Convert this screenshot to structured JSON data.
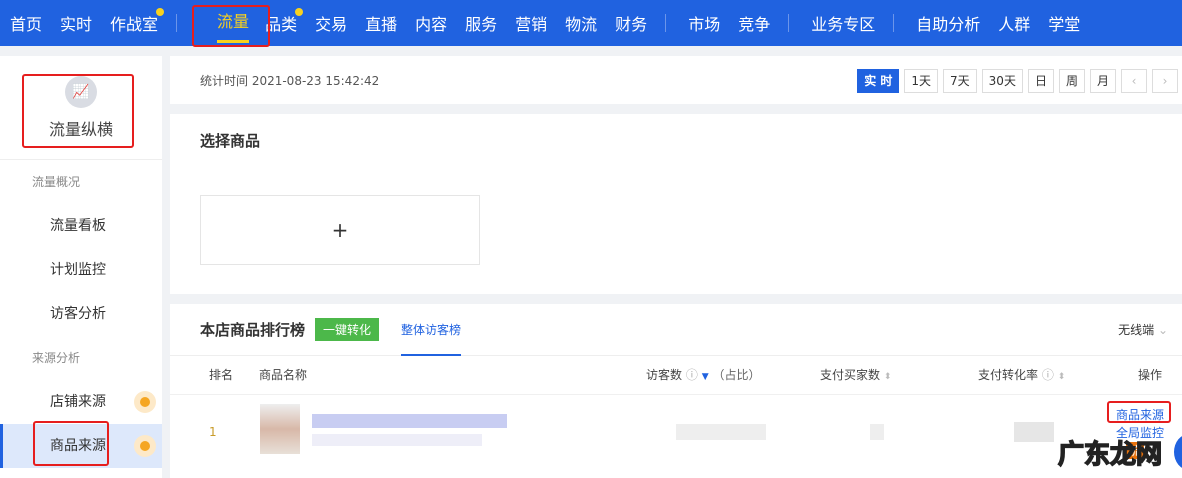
{
  "topnav": {
    "items": [
      "首页",
      "实时",
      "作战室",
      "流量",
      "品类",
      "交易",
      "直播",
      "内容",
      "服务",
      "营销",
      "物流",
      "财务",
      "市场",
      "竞争",
      "业务专区",
      "自助分析",
      "人群",
      "学堂"
    ]
  },
  "sidebar": {
    "title": "流量纵横",
    "group1": "流量概况",
    "items1": [
      "流量看板",
      "计划监控",
      "访客分析"
    ],
    "group2": "来源分析",
    "items2": [
      "店铺来源",
      "商品来源"
    ]
  },
  "timebar": {
    "label": "统计时间 2021-08-23 15:42:42",
    "buttons": [
      "实 时",
      "1天",
      "7天",
      "30天",
      "日",
      "周",
      "月",
      "‹",
      "›"
    ]
  },
  "select": {
    "title": "选择商品",
    "add": "+"
  },
  "ranking": {
    "title": "本店商品排行榜",
    "convert_btn": "一键转化",
    "tab": "整体访客榜",
    "device": "无线端",
    "columns": [
      "排名",
      "商品名称",
      "访客数",
      "（占比）",
      "支付买家数",
      "支付转化率",
      "操作"
    ],
    "row": {
      "rank": "1",
      "actions": [
        "商品来源",
        "全局监控",
        "流"
      ]
    }
  },
  "watermark": "广东龙网"
}
